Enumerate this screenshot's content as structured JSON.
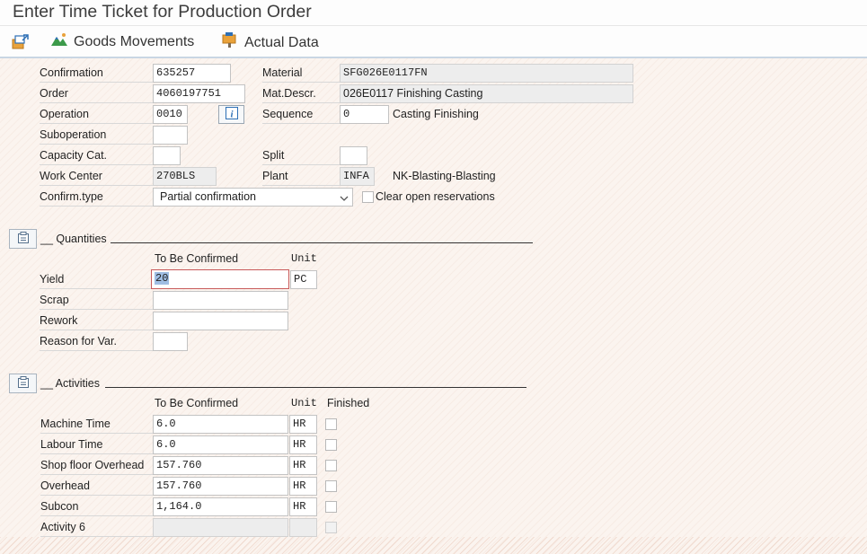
{
  "window": {
    "title": "Enter Time Ticket for Production Order"
  },
  "toolbar": {
    "goods_movements_label": "Goods Movements",
    "actual_data_label": "Actual Data"
  },
  "header": {
    "confirmation_label": "Confirmation",
    "confirmation_value": "635257",
    "order_label": "Order",
    "order_value": "4060197751",
    "operation_label": "Operation",
    "operation_value": "0010",
    "suboperation_label": "Suboperation",
    "suboperation_value": "",
    "capacity_cat_label": "Capacity Cat.",
    "capacity_cat_value": "",
    "work_center_label": "Work Center",
    "work_center_value": "270BLS",
    "confirm_type_label": "Confirm.type",
    "confirm_type_value": "Partial confirmation",
    "material_label": "Material",
    "material_value": "SFG026E0117FN",
    "mat_descr_label": "Mat.Descr.",
    "mat_descr_value": "026E0117 Finishing Casting",
    "sequence_label": "Sequence",
    "sequence_value": "0",
    "sequence_text": "Casting Finishing",
    "split_label": "Split",
    "split_value": "",
    "plant_label": "Plant",
    "plant_value": "INFA",
    "plant_text": "NK-Blasting-Blasting",
    "clear_reservations_label": "Clear open reservations",
    "clear_reservations_checked": false
  },
  "quantities": {
    "section_title": "__ Quantities",
    "col_to_be_confirmed": "To Be Confirmed",
    "col_unit": "Unit",
    "rows": [
      {
        "label": "Yield",
        "value": "20",
        "unit": "PC"
      },
      {
        "label": "Scrap",
        "value": ""
      },
      {
        "label": "Rework",
        "value": ""
      },
      {
        "label": "Reason for Var.",
        "value": ""
      }
    ]
  },
  "activities": {
    "section_title": "__ Activities",
    "col_to_be_confirmed": "To Be Confirmed",
    "col_unit": "Unit",
    "col_finished": "Finished",
    "rows": [
      {
        "label": "Machine Time",
        "value": "6.0",
        "unit": "HR",
        "finished": false
      },
      {
        "label": "Labour Time",
        "value": "6.0",
        "unit": "HR",
        "finished": false
      },
      {
        "label": "Shop floor Overhead",
        "value": "157.760",
        "unit": "HR",
        "finished": false
      },
      {
        "label": "Overhead",
        "value": "157.760",
        "unit": "HR",
        "finished": false
      },
      {
        "label": "Subcon",
        "value": "1,164.0",
        "unit": "HR",
        "finished": false
      },
      {
        "label": "Activity 6",
        "value": "",
        "unit": "",
        "finished": false
      }
    ]
  },
  "colors": {
    "background": "#fbf4ef",
    "field_border": "#c3c3c3",
    "focus_border": "#c85a5a",
    "selection": "#9fbde3"
  }
}
